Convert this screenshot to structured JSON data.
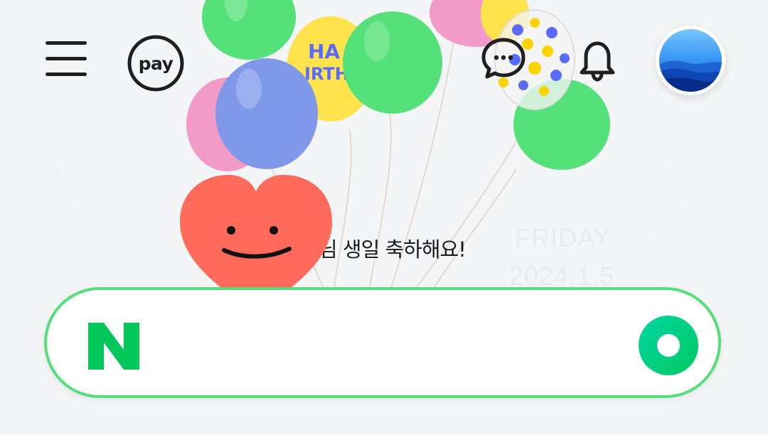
{
  "header": {
    "menu_icon": "hamburger-menu-icon",
    "pay_label": "pay",
    "chat_icon": "chat-bubble-icon",
    "bell_icon": "bell-icon",
    "avatar_icon": "profile-avatar"
  },
  "doodle": {
    "greeting_text": "님 생일 축하해요!",
    "day_name": "FRIDAY",
    "date": "2024.1.5"
  },
  "search": {
    "logo_icon": "naver-n-logo",
    "placeholder": "",
    "value": "",
    "green_dot_icon": "green-dot-icon"
  },
  "colors": {
    "accent": "#55df7a",
    "naver_green": "#03c75a",
    "heart": "#ff6a5a"
  }
}
